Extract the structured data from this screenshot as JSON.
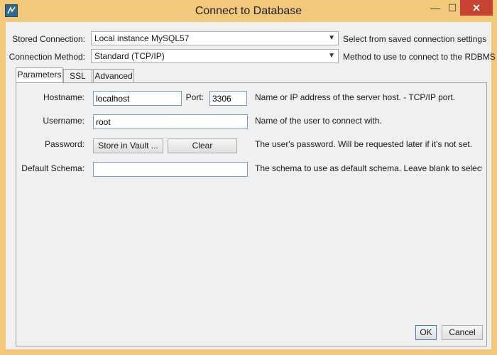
{
  "window": {
    "title": "Connect to Database",
    "minimize": "—",
    "maximize": "☐",
    "close": "✕"
  },
  "form": {
    "stored_connection_label": "Stored Connection:",
    "stored_connection_value": "Local instance MySQL57",
    "stored_connection_desc": "Select from saved connection settings",
    "method_label": "Connection Method:",
    "method_value": "Standard (TCP/IP)",
    "method_desc": "Method to use to connect to the RDBMS"
  },
  "tabs": [
    {
      "label": "Parameters",
      "active": true
    },
    {
      "label": "SSL",
      "active": false
    },
    {
      "label": "Advanced",
      "active": false
    }
  ],
  "params": {
    "hostname_label": "Hostname:",
    "hostname_value": "localhost",
    "port_label": "Port:",
    "port_value": "3306",
    "hostname_desc": "Name or IP address of the server host. - TCP/IP port.",
    "username_label": "Username:",
    "username_value": "root",
    "username_desc": "Name of the user to connect with.",
    "password_label": "Password:",
    "store_vault_label": "Store in Vault ...",
    "clear_label": "Clear",
    "password_desc": "The user's password. Will be requested later if it's not set.",
    "schema_label": "Default Schema:",
    "schema_value": "",
    "schema_desc": "The schema to use as default schema. Leave blank to select it late"
  },
  "footer": {
    "ok_label": "OK",
    "cancel_label": "Cancel"
  },
  "colors": {
    "titlebar": "#f2c97a",
    "close": "#c74232"
  }
}
